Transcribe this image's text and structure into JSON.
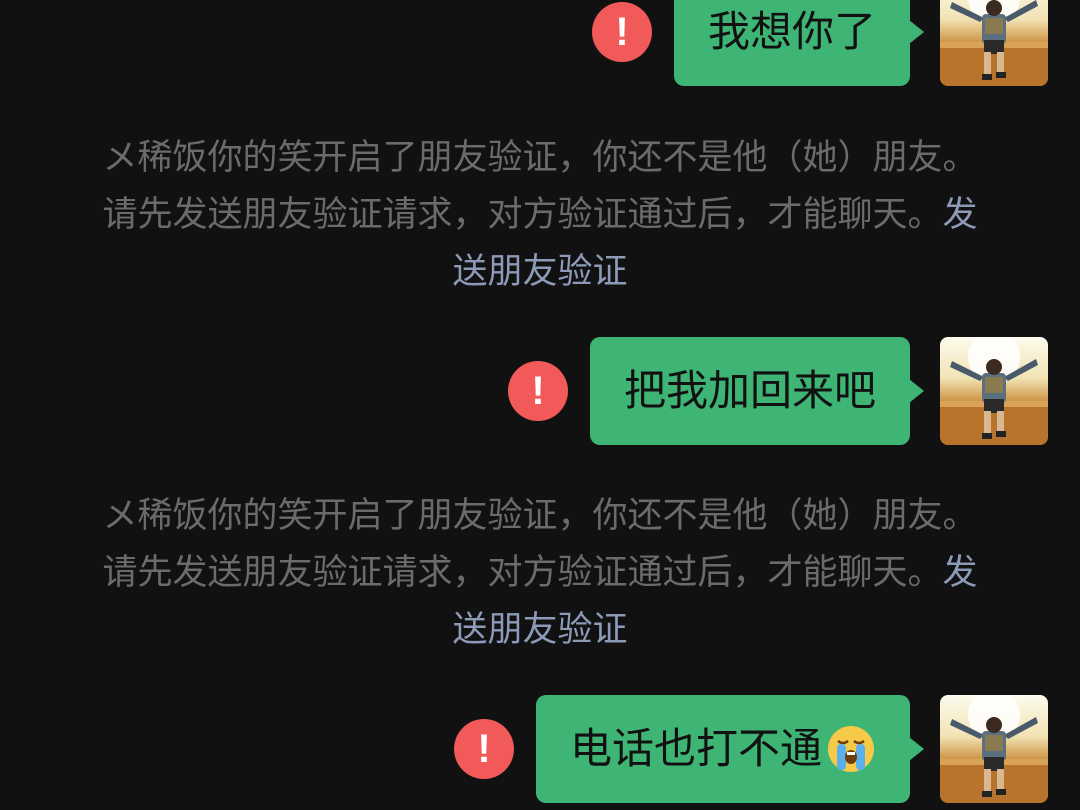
{
  "messages": [
    {
      "text": "我想你了",
      "status_icon": "exclamation-icon"
    },
    {
      "text": "把我加回来吧",
      "status_icon": "exclamation-icon"
    },
    {
      "text": "电话也打不通",
      "emoji": "loudly-crying-face",
      "status_icon": "exclamation-icon"
    }
  ],
  "system_notice": {
    "text": "メ稀饭你的笑开启了朋友验证，你还不是他（她）朋友。请先发送朋友验证请求，对方验证通过后，才能聊天。",
    "link_text": "发送朋友验证"
  },
  "warn_glyph": "!",
  "colors": {
    "background": "#111111",
    "bubble": "#3eb575",
    "warn": "#f25a5a",
    "system_text": "#6b6b6b",
    "link": "#8c9ab8"
  }
}
